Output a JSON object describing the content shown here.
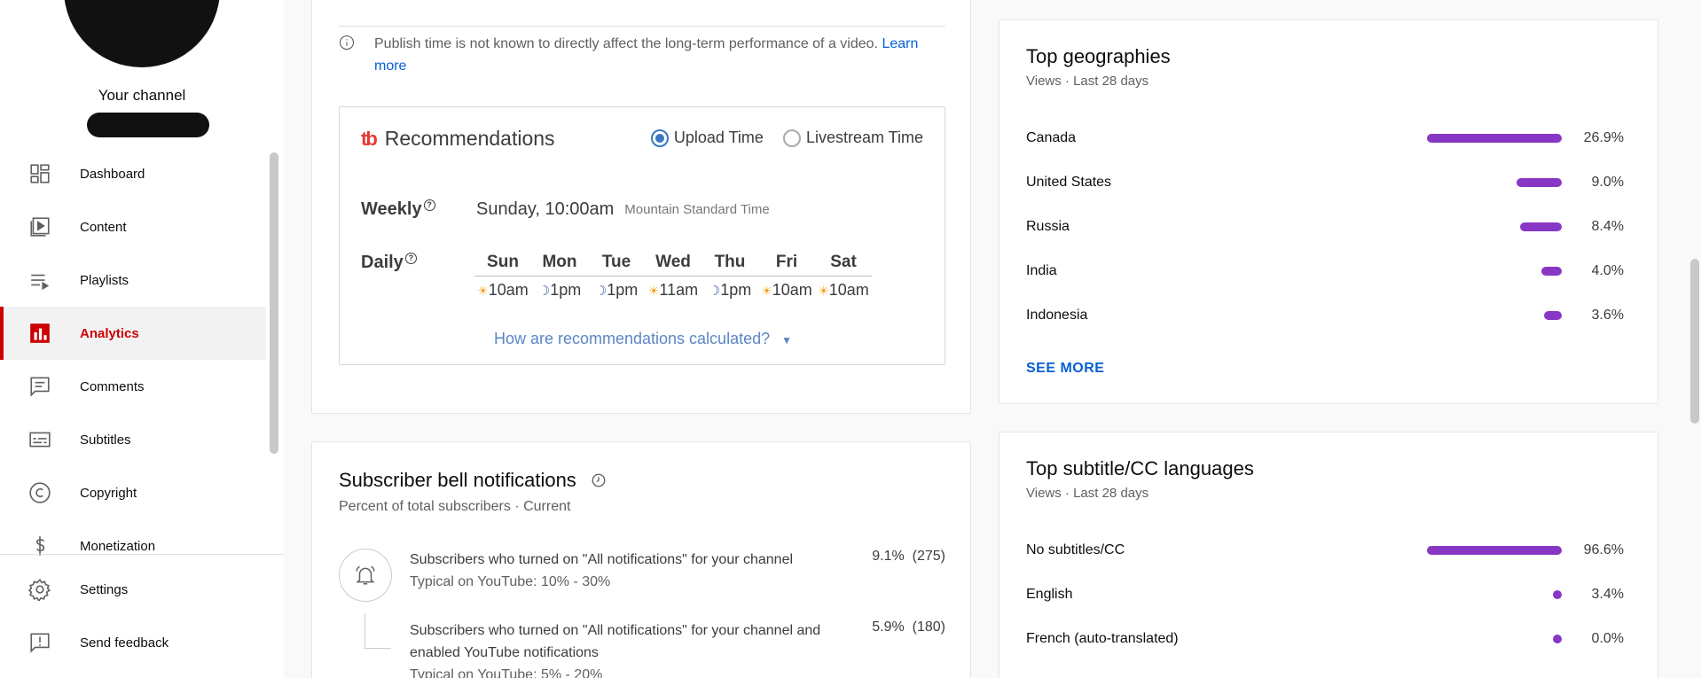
{
  "sidebar": {
    "channel_label": "Your channel",
    "items": [
      {
        "label": "Dashboard",
        "icon": "dashboard-icon"
      },
      {
        "label": "Content",
        "icon": "content-icon"
      },
      {
        "label": "Playlists",
        "icon": "playlists-icon"
      },
      {
        "label": "Analytics",
        "icon": "analytics-icon",
        "active": true
      },
      {
        "label": "Comments",
        "icon": "comments-icon"
      },
      {
        "label": "Subtitles",
        "icon": "subtitles-icon"
      },
      {
        "label": "Copyright",
        "icon": "copyright-icon"
      },
      {
        "label": "Monetization",
        "icon": "monetization-icon"
      }
    ],
    "bottom_items": [
      {
        "label": "Settings",
        "icon": "settings-icon"
      },
      {
        "label": "Send feedback",
        "icon": "feedback-icon"
      }
    ],
    "accent_color": "#cc0000"
  },
  "publish": {
    "info_text": "Publish time is not known to directly affect the long-term performance of a video.",
    "learn_more": "Learn more",
    "recommendations": {
      "title": "Recommendations",
      "logo_text": "tb",
      "upload_time": "Upload Time",
      "livestream_time": "Livestream Time",
      "selected": "Upload Time",
      "weekly_label": "Weekly",
      "weekly_value": "Sunday, 10:00am",
      "timezone": "Mountain Standard Time",
      "daily_label": "Daily",
      "days": [
        {
          "name": "Sun",
          "time": "10am",
          "icon": "sun-icon"
        },
        {
          "name": "Mon",
          "time": "1pm",
          "icon": "moon-icon"
        },
        {
          "name": "Tue",
          "time": "1pm",
          "icon": "moon-icon"
        },
        {
          "name": "Wed",
          "time": "11am",
          "icon": "sun-icon"
        },
        {
          "name": "Thu",
          "time": "1pm",
          "icon": "moon-icon"
        },
        {
          "name": "Fri",
          "time": "10am",
          "icon": "sun-icon"
        },
        {
          "name": "Sat",
          "time": "10am",
          "icon": "sun-icon"
        }
      ],
      "how_calculated": "How are recommendations calculated?"
    }
  },
  "bell": {
    "title": "Subscriber bell notifications",
    "subtitle": "Percent of total subscribers · Current",
    "rows": [
      {
        "text": "Subscribers who turned on \"All notifications\" for your channel",
        "typical": "Typical on YouTube: 10% - 30%",
        "value": "9.1%",
        "count": "(275)"
      },
      {
        "text": "Subscribers who turned on \"All notifications\" for your channel and enabled YouTube notifications",
        "typical": "Typical on YouTube: 5% - 20%",
        "value": "5.9%",
        "count": "(180)"
      }
    ]
  },
  "geographies": {
    "title": "Top geographies",
    "subtitle": "Views · Last 28 days",
    "rows": [
      {
        "label": "Canada",
        "value": "26.9%",
        "fraction": 26.9
      },
      {
        "label": "United States",
        "value": "9.0%",
        "fraction": 9.0
      },
      {
        "label": "Russia",
        "value": "8.4%",
        "fraction": 8.4
      },
      {
        "label": "India",
        "value": "4.0%",
        "fraction": 4.0
      },
      {
        "label": "Indonesia",
        "value": "3.6%",
        "fraction": 3.6
      }
    ],
    "see_more": "SEE MORE",
    "bar_color": "#8737c4"
  },
  "subtitles": {
    "title": "Top subtitle/CC languages",
    "subtitle": "Views · Last 28 days",
    "rows": [
      {
        "label": "No subtitles/CC",
        "value": "96.6%",
        "fraction": 96.6
      },
      {
        "label": "English",
        "value": "3.4%",
        "fraction": 3.4
      },
      {
        "label": "French (auto-translated)",
        "value": "0.0%",
        "fraction": 0.0
      }
    ]
  }
}
